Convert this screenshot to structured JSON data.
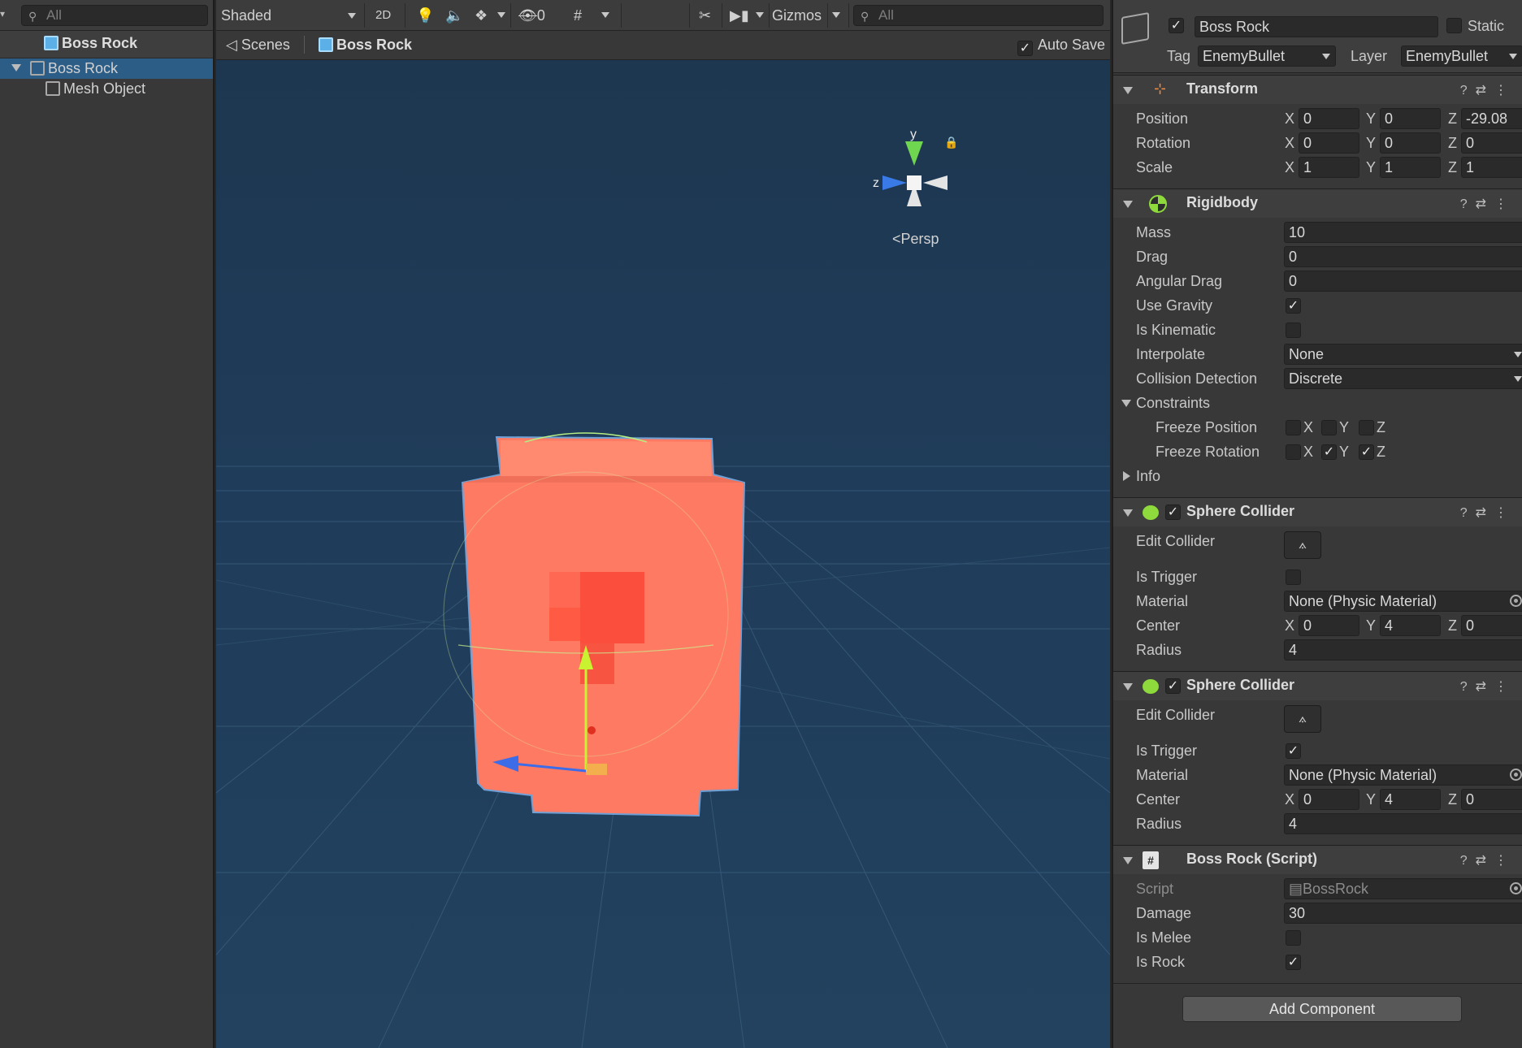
{
  "hierarchy": {
    "search_placeholder": "All",
    "scene_title": "Boss Rock",
    "items": [
      {
        "label": "Boss Rock"
      },
      {
        "label": "Mesh Object"
      }
    ]
  },
  "scene": {
    "toolbar": {
      "shading_mode": "Shaded",
      "mode_2d": "2D",
      "hidden_count": "0",
      "gizmos": "Gizmos",
      "search_placeholder": "All"
    },
    "breadcrumb": {
      "root": "Scenes",
      "current": "Boss Rock"
    },
    "auto_save": "Auto Save",
    "gizmo": {
      "y": "y",
      "z": "z",
      "projection": "Persp"
    }
  },
  "inspector": {
    "object_name": "Boss Rock",
    "static_label": "Static",
    "tag_label": "Tag",
    "tag_value": "EnemyBullet",
    "layer_label": "Layer",
    "layer_value": "EnemyBullet",
    "transform": {
      "title": "Transform",
      "position_label": "Position",
      "rotation_label": "Rotation",
      "scale_label": "Scale",
      "position": {
        "x": "0",
        "y": "0",
        "z": "-29.08"
      },
      "rotation": {
        "x": "0",
        "y": "0",
        "z": "0"
      },
      "scale": {
        "x": "1",
        "y": "1",
        "z": "1"
      },
      "x": "X",
      "y": "Y",
      "z": "Z"
    },
    "rigidbody": {
      "title": "Rigidbody",
      "mass_label": "Mass",
      "mass": "10",
      "drag_label": "Drag",
      "drag": "0",
      "angular_drag_label": "Angular Drag",
      "angular_drag": "0",
      "use_gravity_label": "Use Gravity",
      "is_kinematic_label": "Is Kinematic",
      "interpolate_label": "Interpolate",
      "interpolate": "None",
      "collision_label": "Collision Detection",
      "collision": "Discrete",
      "constraints_label": "Constraints",
      "freeze_position_label": "Freeze Position",
      "freeze_rotation_label": "Freeze Rotation",
      "info_label": "Info"
    },
    "sphere_collider_1": {
      "title": "Sphere Collider",
      "edit_label": "Edit Collider",
      "is_trigger_label": "Is Trigger",
      "material_label": "Material",
      "material": "None (Physic Material)",
      "center_label": "Center",
      "center": {
        "x": "0",
        "y": "4",
        "z": "0"
      },
      "radius_label": "Radius",
      "radius": "4"
    },
    "sphere_collider_2": {
      "title": "Sphere Collider",
      "edit_label": "Edit Collider",
      "is_trigger_label": "Is Trigger",
      "material_label": "Material",
      "material": "None (Physic Material)",
      "center_label": "Center",
      "center": {
        "x": "0",
        "y": "4",
        "z": "0"
      },
      "radius_label": "Radius",
      "radius": "4"
    },
    "script": {
      "title": "Boss Rock (Script)",
      "script_label": "Script",
      "script_value": "BossRock",
      "damage_label": "Damage",
      "damage": "30",
      "is_melee_label": "Is Melee",
      "is_rock_label": "Is Rock"
    },
    "add_component": "Add Component"
  },
  "colors": {
    "selection": "#2c5d87",
    "rock": "#ff7a62",
    "viewport_bg": "#1f3c5a"
  }
}
